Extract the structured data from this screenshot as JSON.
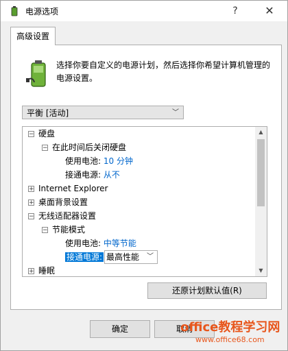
{
  "window": {
    "title": "电源选项",
    "help_label": "?",
    "close_label": "✕"
  },
  "tab": {
    "label": "高级设置"
  },
  "intro": {
    "text": "选择你要自定义的电源计划，然后选择你希望计算机管理的电源设置。"
  },
  "plan_select": {
    "value": "平衡 [活动]"
  },
  "tree": {
    "hdd": "硬盘",
    "hdd_off": "在此时间后关闭硬盘",
    "battery_label": "使用电池:",
    "hdd_battery_value": "10 分钟",
    "plugged_label": "接通电源:",
    "hdd_plugged_value": "从不",
    "ie": "Internet Explorer",
    "desktop_bg": "桌面背景设置",
    "wireless": "无线适配器设置",
    "power_save": "节能模式",
    "ps_battery_value": "中等节能",
    "ps_plugged_value": "最高性能",
    "sleep": "睡眠"
  },
  "buttons": {
    "restore": "还原计划默认值(R)",
    "ok": "确定",
    "cancel": "取消"
  },
  "watermark": {
    "line1": "office教程学习网",
    "line2": "www.office68.com"
  },
  "icons": {
    "app": "battery-power-icon",
    "plan": "battery-plug-icon"
  },
  "colors": {
    "accent": "#0078d7",
    "value_link": "#0066cc",
    "watermark": "#e8561c"
  }
}
